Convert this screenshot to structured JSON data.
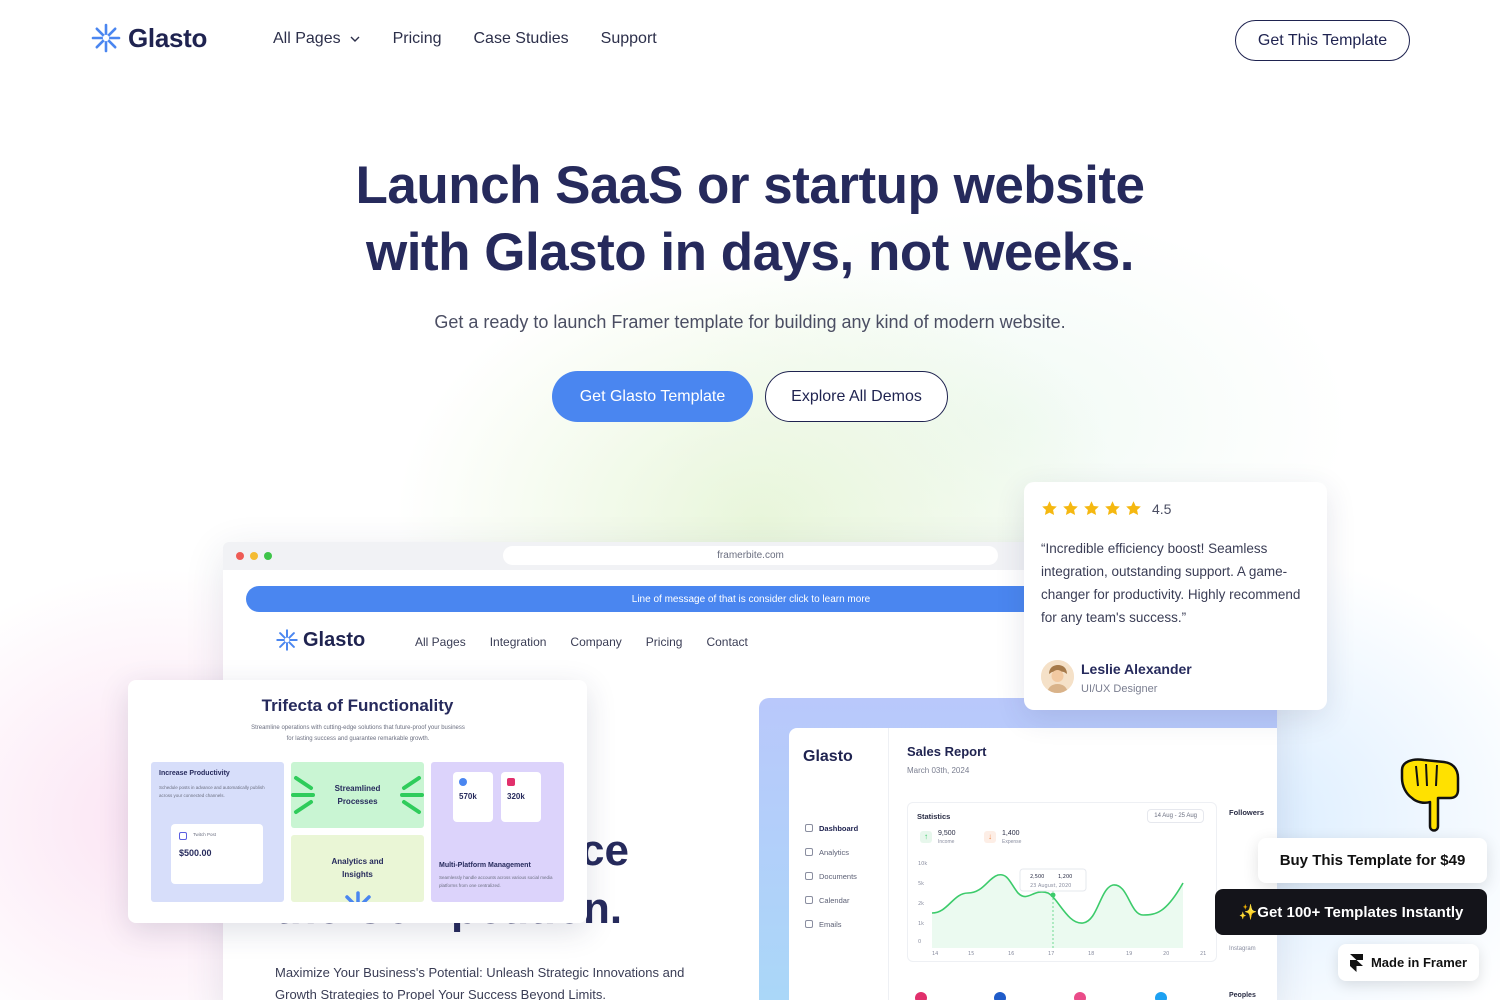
{
  "brand": {
    "name": "Glasto",
    "accent": "#4A86F0",
    "navy": "#262A5C"
  },
  "nav": {
    "items": [
      {
        "label": "All Pages",
        "has_dropdown": true
      },
      {
        "label": "Pricing"
      },
      {
        "label": "Case Studies"
      },
      {
        "label": "Support"
      }
    ],
    "cta": "Get This Template"
  },
  "hero": {
    "title_line1": "Launch SaaS or startup website",
    "title_line2": "with Glasto in days, not weeks.",
    "subtitle": "Get a ready to launch Framer template for building any kind of modern website.",
    "primary_button": "Get Glasto Template",
    "secondary_button": "Explore All Demos"
  },
  "preview": {
    "url": "framerbite.com",
    "announcement": "Line of message of that is consider click to learn more",
    "logo": "Glasto",
    "nav": [
      "All Pages",
      "Integration",
      "Company",
      "Pricing",
      "Contact"
    ],
    "headline_line1": "ce",
    "headline_line2": "the Competition.",
    "paragraph": "Maximize Your Business's Potential: Unleash Strategic Innovations and Growth Strategies to Propel Your Success Beyond Limits."
  },
  "dashboard": {
    "logo": "Glasto",
    "menu": [
      "Dashboard",
      "Analytics",
      "Documents",
      "Calendar",
      "Emails"
    ],
    "title": "Sales Report",
    "date": "March 03th, 2024",
    "stats_title": "Statistics",
    "range": "14 Aug - 25 Aug",
    "income_value": "9,500",
    "income_label": "Income",
    "expense_value": "1,400",
    "expense_label": "Expense",
    "tooltip_a": "2,500",
    "tooltip_b": "1,200",
    "tooltip_date": "23 August, 2020",
    "y_ticks": [
      "10k",
      "5k",
      "2k",
      "1k",
      "0"
    ],
    "x_ticks": [
      "14",
      "15",
      "16",
      "17",
      "18",
      "19",
      "20",
      "21"
    ],
    "followers": "Followers",
    "instagram": "Instagram",
    "peoples": "Peoples",
    "line_color": "#3CCB6B"
  },
  "feature_card": {
    "title": "Trifecta of Functionality",
    "subtitle": "Streamline operations with cutting-edge solutions that future-proof your business for lasting success and guarantee remarkable growth.",
    "tile1_title": "Increase Productivity",
    "tile1_desc": "Schedule posts in advance and automatically publish across your connected channels.",
    "tile1_post": "Twitch Post",
    "tile1_amount": "$500.00",
    "tile2_title": "Streamlined Processes",
    "tile3_title": "Analytics and Insights",
    "tile4_stat1": "570k",
    "tile4_stat2": "320k",
    "tile4_title": "Multi-Platform Management",
    "tile4_desc": "Seamlessly handle accounts across various social media platforms from one centralized."
  },
  "testimonial": {
    "rating": "4.5",
    "stars": 5,
    "quote": "“Incredible efficiency boost! Seamless integration, outstanding support. A game-changer for productivity. Highly recommend for any team's success.”",
    "author": "Leslie Alexander",
    "role": "UI/UX Designer"
  },
  "floating": {
    "buy": "Buy This Template for $49",
    "get_more": "✨Get 100+ Templates Instantly",
    "made_in": "Made in Framer"
  }
}
